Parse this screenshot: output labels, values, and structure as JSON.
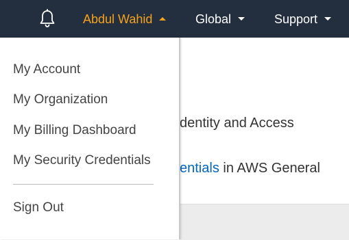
{
  "topbar": {
    "bell_icon": "bell-icon",
    "user_label": "Abdul Wahid",
    "global_label": "Global",
    "support_label": "Support",
    "colors": {
      "background": "#232f3e",
      "active": "#f7a21b",
      "text": "#ffffff"
    }
  },
  "background_page": {
    "line1_text": "dentity and Access",
    "line2_link": "entials",
    "line2_text": " in AWS General"
  },
  "user_menu": {
    "items": [
      {
        "label": "My Account"
      },
      {
        "label": "My Organization"
      },
      {
        "label": "My Billing Dashboard"
      },
      {
        "label": "My Security Credentials"
      }
    ],
    "sign_out_label": "Sign Out"
  }
}
